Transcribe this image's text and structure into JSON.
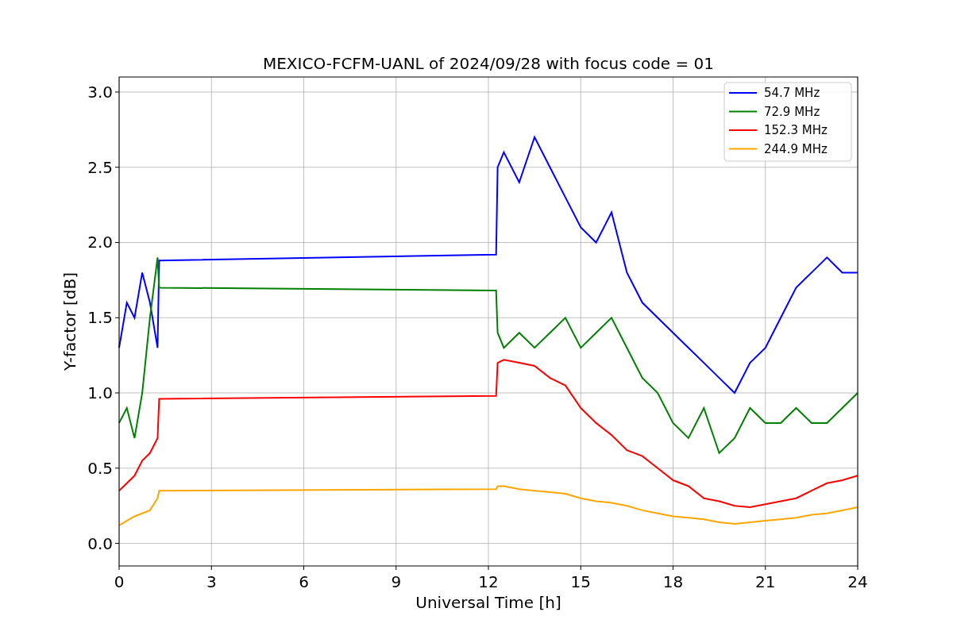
{
  "chart_data": {
    "type": "line",
    "title": "MEXICO-FCFM-UANL of 2024/09/28 with focus code = 01",
    "xlabel": "Universal Time [h]",
    "ylabel": "Y-factor [dB]",
    "x": [
      0,
      0.25,
      0.5,
      0.75,
      1,
      1.25,
      1.3,
      12.25,
      12.3,
      12.5,
      13,
      13.5,
      14,
      14.5,
      15,
      15.5,
      16,
      16.5,
      17,
      17.5,
      18,
      18.5,
      19,
      19.5,
      20,
      20.5,
      21,
      21.5,
      22,
      22.5,
      23,
      23.5,
      24
    ],
    "series": [
      {
        "name": "54.7 MHz",
        "color": "#0000ff",
        "values": [
          1.3,
          1.6,
          1.5,
          1.8,
          1.6,
          1.3,
          1.88,
          1.92,
          2.5,
          2.6,
          2.4,
          2.7,
          2.5,
          2.3,
          2.1,
          2.0,
          2.2,
          1.8,
          1.6,
          1.5,
          1.4,
          1.3,
          1.2,
          1.1,
          1.0,
          1.2,
          1.3,
          1.5,
          1.7,
          1.8,
          1.9,
          1.8,
          1.8
        ]
      },
      {
        "name": "72.9 MHz",
        "color": "#008000",
        "values": [
          0.8,
          0.9,
          0.7,
          1.0,
          1.5,
          1.9,
          1.7,
          1.68,
          1.4,
          1.3,
          1.4,
          1.3,
          1.4,
          1.5,
          1.3,
          1.4,
          1.5,
          1.3,
          1.1,
          1.0,
          0.8,
          0.7,
          0.9,
          0.6,
          0.7,
          0.9,
          0.8,
          0.8,
          0.9,
          0.8,
          0.8,
          0.9,
          1.0
        ]
      },
      {
        "name": "152.3 MHz",
        "color": "#ff0000",
        "values": [
          0.35,
          0.4,
          0.45,
          0.55,
          0.6,
          0.7,
          0.96,
          0.98,
          1.2,
          1.22,
          1.2,
          1.18,
          1.1,
          1.05,
          0.9,
          0.8,
          0.72,
          0.62,
          0.58,
          0.5,
          0.42,
          0.38,
          0.3,
          0.28,
          0.25,
          0.24,
          0.26,
          0.28,
          0.3,
          0.35,
          0.4,
          0.42,
          0.45
        ]
      },
      {
        "name": "244.9 MHz",
        "color": "#ffa500",
        "values": [
          0.12,
          0.15,
          0.18,
          0.2,
          0.22,
          0.3,
          0.35,
          0.36,
          0.38,
          0.38,
          0.36,
          0.35,
          0.34,
          0.33,
          0.3,
          0.28,
          0.27,
          0.25,
          0.22,
          0.2,
          0.18,
          0.17,
          0.16,
          0.14,
          0.13,
          0.14,
          0.15,
          0.16,
          0.17,
          0.19,
          0.2,
          0.22,
          0.24
        ]
      }
    ],
    "grid": true,
    "legend": true,
    "xlim": [
      0,
      24
    ],
    "ylim": [
      -0.15,
      3.1
    ],
    "xticks": [
      0,
      3,
      6,
      9,
      12,
      15,
      18,
      21,
      24
    ],
    "yticks": [
      {
        "value": 0,
        "label": "0.0"
      },
      {
        "value": 0.5,
        "label": "0.5"
      },
      {
        "value": 1,
        "label": "1.0"
      },
      {
        "value": 1.5,
        "label": "1.5"
      },
      {
        "value": 2,
        "label": "2.0"
      },
      {
        "value": 2.5,
        "label": "2.5"
      },
      {
        "value": 3,
        "label": "3.0"
      }
    ]
  }
}
